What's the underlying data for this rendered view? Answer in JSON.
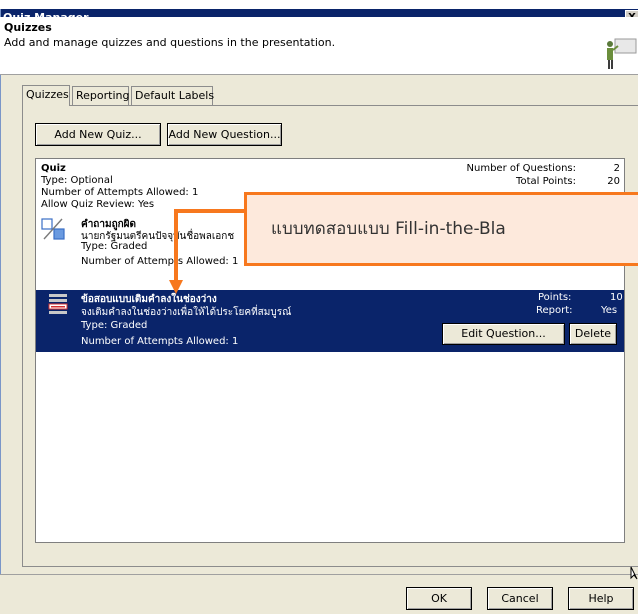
{
  "window": {
    "title": "Quiz Manager",
    "close_glyph": "X"
  },
  "header": {
    "title": "Quizzes",
    "description": "Add and manage quizzes and questions in the presentation."
  },
  "tabs": [
    {
      "label": "Quizzes"
    },
    {
      "label": "Reporting"
    },
    {
      "label": "Default Labels"
    }
  ],
  "toolbar": {
    "add_quiz": "Add New Quiz...",
    "add_question": "Add New Question..."
  },
  "quiz": {
    "title": "Quiz",
    "type": "Type: Optional",
    "attempts": "Number of Attempts Allowed: 1",
    "review": "Allow Quiz Review: Yes",
    "num_questions_label": "Number of Questions:",
    "num_questions_value": "2",
    "total_points_label": "Total Points:",
    "total_points_value": "20"
  },
  "questions": [
    {
      "title": "คำถามถูกผิด",
      "text": "นายกรัฐมนตรีคนปัจจุบันชื่อพลเอกช",
      "type": "Type: Graded",
      "attempts": "Number of Attempts Allowed: 1"
    },
    {
      "title": "ข้อสอบแบบเติมคำลงในช่องว่าง",
      "text": "จงเติมคำลงในช่องว่างเพื่อให้ได้ประโยคที่สมบูรณ์",
      "type": "Type: Graded",
      "attempts": "Number of Attempts Allowed: 1",
      "points_label": "Points:",
      "points_value": "10",
      "report_label": "Report:",
      "report_value": "Yes",
      "edit_label": "Edit Question...",
      "delete_label": "Delete"
    }
  ],
  "callout": {
    "text": "แบบทดสอบแบบ  Fill-in-the-Bla",
    "color": "#f7781e"
  },
  "footer": {
    "ok": "OK",
    "cancel": "Cancel",
    "help": "Help"
  },
  "colors": {
    "selection": "#0a246a",
    "titlebar": "#0a246a",
    "dialog_bg": "#ece9d8"
  }
}
